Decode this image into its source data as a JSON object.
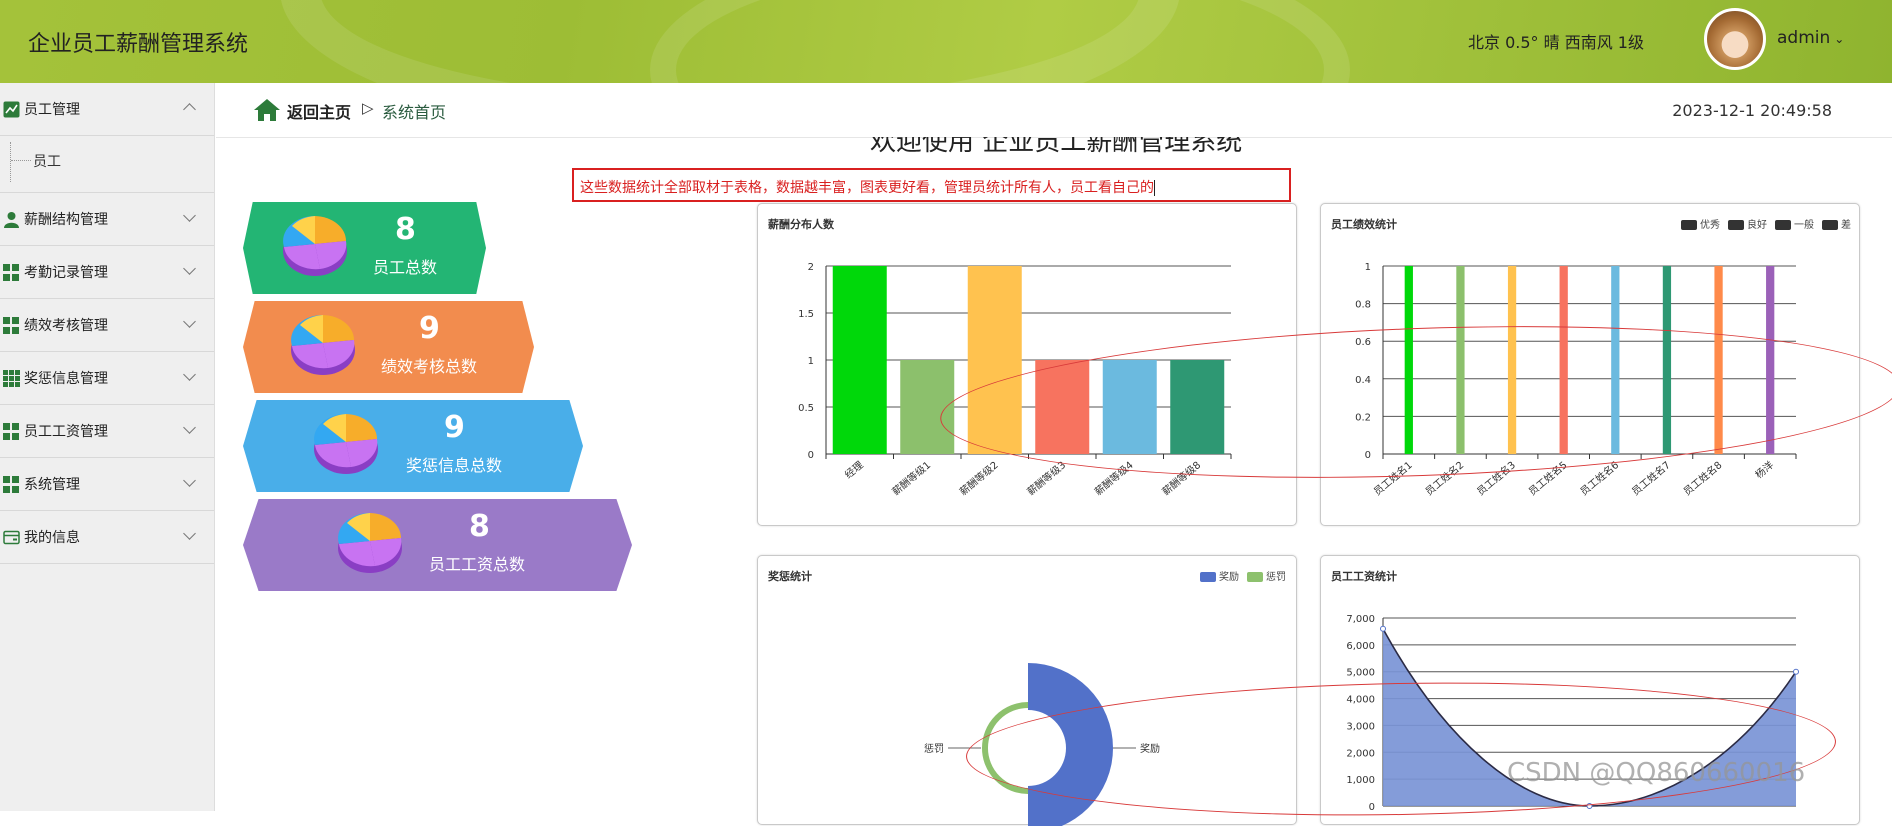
{
  "header": {
    "app_title": "企业员工薪酬管理系统",
    "weather": "北京  0.5° 晴  西南风  1级",
    "username": "admin",
    "caret": "⌄"
  },
  "sidebar": {
    "items": [
      {
        "label": "员工管理",
        "icon": "chart-line-icon",
        "expanded": true,
        "children": [
          "员工"
        ]
      },
      {
        "label": "薪酬结构管理",
        "icon": "user-icon"
      },
      {
        "label": "考勤记录管理",
        "icon": "grid-icon"
      },
      {
        "label": "绩效考核管理",
        "icon": "grid-icon"
      },
      {
        "label": "奖惩信息管理",
        "icon": "grid9-icon"
      },
      {
        "label": "员工工资管理",
        "icon": "grid-icon"
      },
      {
        "label": "系统管理",
        "icon": "grid-icon"
      },
      {
        "label": "我的信息",
        "icon": "card-icon"
      }
    ]
  },
  "breadcrumb": {
    "back": "返回主页",
    "arrow": "▷",
    "current": "系统首页",
    "datetime": "2023-12-1 20:49:58"
  },
  "welcome": "欢迎使用 企业员工薪酬管理系统",
  "note": "这些数据统计全部取材于表格，数据越丰富，图表更好看，管理员统计所有人，员工看自己的",
  "stats": [
    {
      "value": "8",
      "label": "员工总数",
      "color": "#23b574"
    },
    {
      "value": "9",
      "label": "绩效考核总数",
      "color": "#f28c4e"
    },
    {
      "value": "9",
      "label": "奖惩信息总数",
      "color": "#49aee9"
    },
    {
      "value": "8",
      "label": "员工工资总数",
      "color": "#9a7ac8"
    }
  ],
  "watermark": "CSDN @QQ860660016",
  "chart_data": [
    {
      "type": "bar",
      "title": "薪酬分布人数",
      "categories": [
        "经理",
        "薪酬等级1",
        "薪酬等级2",
        "薪酬等级3",
        "薪酬等级4",
        "薪酬等级8"
      ],
      "values": [
        2,
        1,
        2,
        1,
        1,
        1
      ],
      "colors": [
        "#00d80a",
        "#8cc06c",
        "#ffc24f",
        "#f7735f",
        "#6bbadf",
        "#2e9873"
      ],
      "ylim": [
        0,
        2
      ],
      "yticks": [
        "0",
        "0.5",
        "1",
        "1.5",
        "2"
      ]
    },
    {
      "type": "bar",
      "title": "员工绩效统计",
      "legend": [
        "优秀",
        "良好",
        "一般",
        "差"
      ],
      "categories": [
        "员工姓名1",
        "员工姓名2",
        "员工姓名3",
        "员工姓名5",
        "员工姓名6",
        "员工姓名7",
        "员工姓名8",
        "杨洋"
      ],
      "values": [
        1,
        1,
        1,
        1,
        1,
        1,
        1,
        1
      ],
      "colors": [
        "#00d80a",
        "#8cc06c",
        "#ffc24f",
        "#f7735f",
        "#6bbadf",
        "#2e9873",
        "#ff8a4a",
        "#9b61b8"
      ],
      "ylim": [
        0,
        1
      ],
      "yticks": [
        "0",
        "0.2",
        "0.4",
        "0.6",
        "0.8",
        "1"
      ]
    },
    {
      "type": "pie",
      "title": "奖惩统计",
      "legend": [
        "奖励",
        "惩罚"
      ],
      "labels": [
        "奖励",
        "惩罚"
      ],
      "colors": [
        "#5271c9",
        "#8dc16d"
      ]
    },
    {
      "type": "area",
      "title": "员工工资统计",
      "yticks": [
        "0",
        "1,000",
        "2,000",
        "3,000",
        "4,000",
        "5,000",
        "6,000",
        "7,000"
      ],
      "ylim": [
        0,
        7000
      ],
      "values": [
        6600,
        0,
        5000
      ],
      "color": "#7a94d6"
    }
  ]
}
